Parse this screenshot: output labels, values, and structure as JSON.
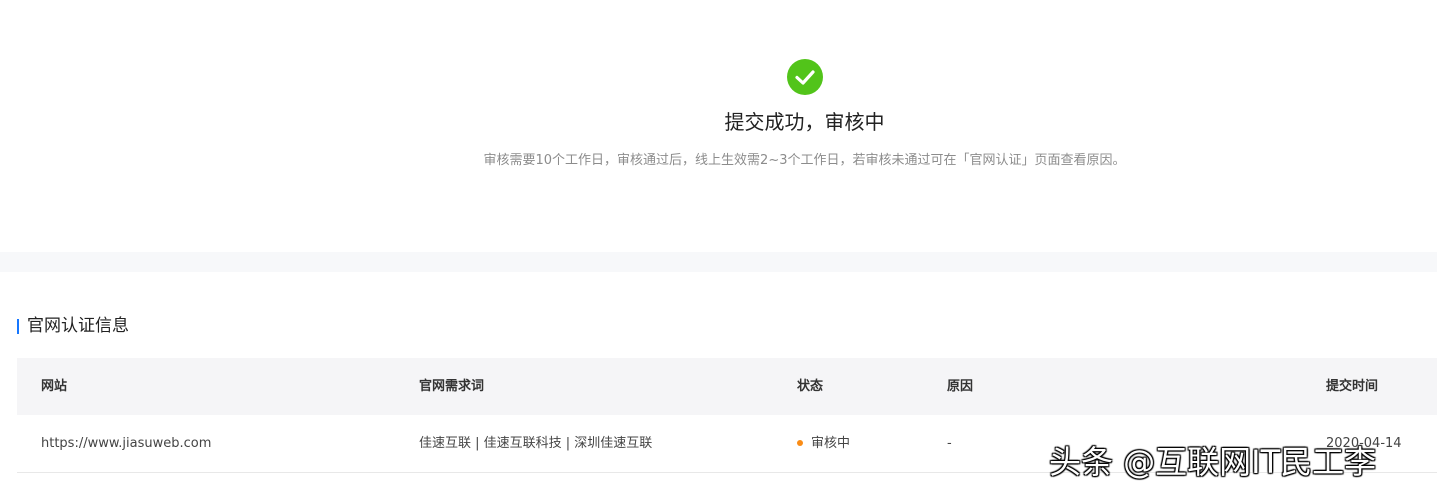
{
  "result": {
    "icon": "check-circle-icon",
    "icon_color": "#52c41a",
    "title": "提交成功，审核中",
    "description": "审核需要10个工作日，审核通过后，线上生效需2~3个工作日，若审核未通过可在「官网认证」页面查看原因。"
  },
  "info_section": {
    "heading": "官网认证信息",
    "accent_color": "#1677ff",
    "table": {
      "headers": [
        "网站",
        "官网需求词",
        "状态",
        "原因",
        "提交时间"
      ],
      "rows": [
        {
          "website": "https://www.jiasuweb.com",
          "keywords": "佳速互联 | 佳速互联科技 | 深圳佳速互联",
          "status": "审核中",
          "status_color": "#fa8c16",
          "reason": "-",
          "submit_time": "2020-04-14"
        }
      ]
    }
  },
  "watermark": "头条 @互联网IT民工李"
}
